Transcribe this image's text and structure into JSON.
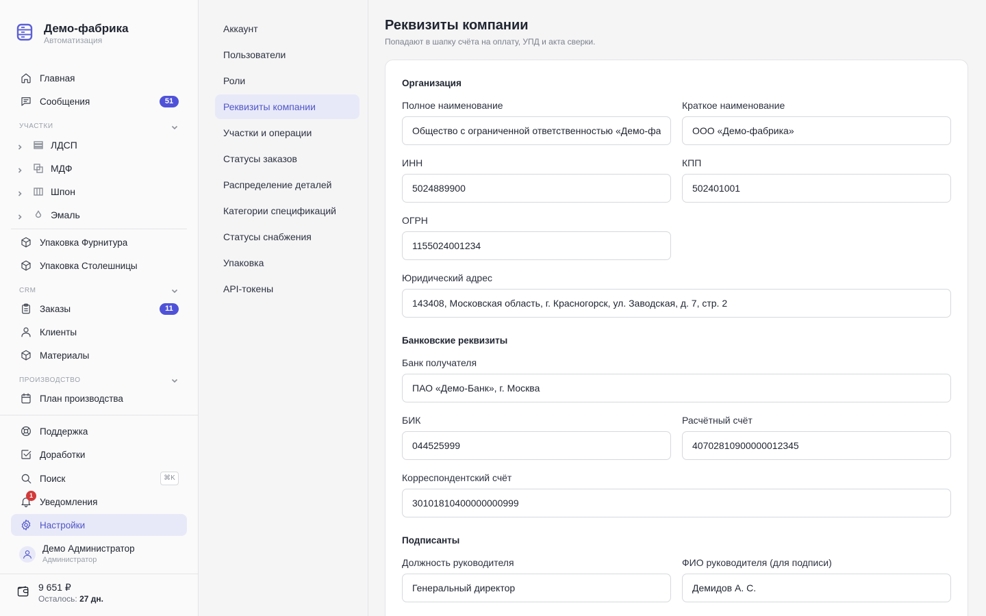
{
  "brand": {
    "title": "Демо-фабрика",
    "subtitle": "Автоматизация"
  },
  "nav": {
    "home": "Главная",
    "messages": {
      "label": "Сообщения",
      "badge": "51"
    },
    "sections": {
      "workshops": "Участки",
      "crm": "CRM",
      "production": "Производство"
    },
    "workshops": [
      "ЛДСП",
      "МДФ",
      "Шпон",
      "Эмаль"
    ],
    "packaging_hardware": "Упаковка Фурнитура",
    "packaging_tops": "Упаковка Столешницы",
    "orders": {
      "label": "Заказы",
      "badge": "11"
    },
    "clients": "Клиенты",
    "materials": "Материалы",
    "production_plan": "План производства",
    "support": "Поддержка",
    "improvements": "Доработки",
    "search": {
      "label": "Поиск",
      "shortcut": "⌘K"
    },
    "notifications": {
      "label": "Уведомления",
      "count": "1"
    },
    "settings": "Настройки"
  },
  "user": {
    "name": "Демо Администратор",
    "role": "Администратор"
  },
  "balance": {
    "amount": "9 651 ₽",
    "left_label": "Осталось:",
    "left_value": "27 дн."
  },
  "settings_menu": [
    "Аккаунт",
    "Пользователи",
    "Роли",
    "Реквизиты компании",
    "Участки и операции",
    "Статусы заказов",
    "Распределение деталей",
    "Категории спецификаций",
    "Статусы снабжения",
    "Упаковка",
    "API-токены"
  ],
  "settings_menu_active": "Реквизиты компании",
  "page": {
    "title": "Реквизиты компании",
    "subtitle": "Попадают в шапку счёта на оплату, УПД и акта сверки."
  },
  "form": {
    "org_title": "Организация",
    "full_name": {
      "label": "Полное наименование",
      "value": "Общество с ограниченной ответственностью «Демо-фабрика»"
    },
    "short_name": {
      "label": "Краткое наименование",
      "value": "ООО «Демо-фабрика»"
    },
    "inn": {
      "label": "ИНН",
      "value": "5024889900"
    },
    "kpp": {
      "label": "КПП",
      "value": "502401001"
    },
    "ogrn": {
      "label": "ОГРН",
      "value": "1155024001234"
    },
    "address": {
      "label": "Юридический адрес",
      "value": "143408, Московская область, г. Красногорск, ул. Заводская, д. 7, стр. 2"
    },
    "bank_title": "Банковские реквизиты",
    "bank": {
      "label": "Банк получателя",
      "value": "ПАО «Демо-Банк», г. Москва"
    },
    "bik": {
      "label": "БИК",
      "value": "044525999"
    },
    "account": {
      "label": "Расчётный счёт",
      "value": "40702810900000012345"
    },
    "corr_account": {
      "label": "Корреспондентский счёт",
      "value": "30101810400000000999"
    },
    "signers_title": "Подписанты",
    "head_position": {
      "label": "Должность руководителя",
      "value": "Генеральный директор"
    },
    "head_name": {
      "label": "ФИО руководителя (для подписи)",
      "value": "Демидов А. С."
    }
  }
}
